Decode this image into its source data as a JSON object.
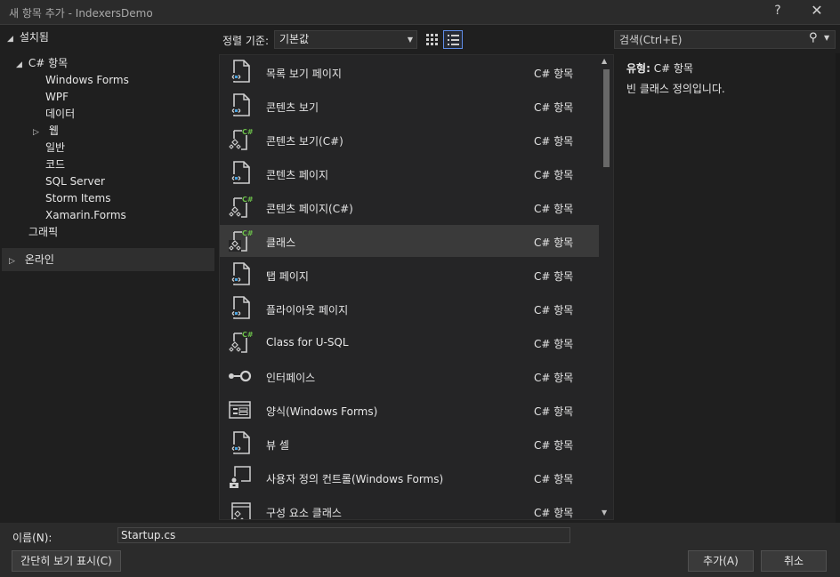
{
  "window": {
    "title": "새 항목 추가 - IndexersDemo",
    "help_glyph": "?",
    "close_glyph": "✕"
  },
  "tree": {
    "installed": "설치됨",
    "csharp_items": "C# 항목",
    "children": [
      "Windows Forms",
      "WPF",
      "데이터",
      "웹",
      "일반",
      "코드",
      "SQL Server",
      "Storm Items",
      "Xamarin.Forms"
    ],
    "graphics": "그래픽",
    "online": "온라인"
  },
  "toolbar": {
    "sort_label": "정렬 기준:",
    "sort_value": "기본값",
    "search_placeholder": "검색(Ctrl+E)"
  },
  "templates": [
    {
      "name": "목록 보기 페이지",
      "type": "C# 항목",
      "icon": "xaml-page-icon"
    },
    {
      "name": "콘텐츠 보기",
      "type": "C# 항목",
      "icon": "xaml-page-icon"
    },
    {
      "name": "콘텐츠 보기(C#)",
      "type": "C# 항목",
      "icon": "csharp-class-icon"
    },
    {
      "name": "콘텐츠 페이지",
      "type": "C# 항목",
      "icon": "xaml-page-icon"
    },
    {
      "name": "콘텐츠 페이지(C#)",
      "type": "C# 항목",
      "icon": "csharp-class-icon"
    },
    {
      "name": "클래스",
      "type": "C# 항목",
      "icon": "csharp-class-icon",
      "selected": true
    },
    {
      "name": "탭 페이지",
      "type": "C# 항목",
      "icon": "xaml-page-icon"
    },
    {
      "name": "플라이아웃 페이지",
      "type": "C# 항목",
      "icon": "xaml-page-icon"
    },
    {
      "name": "Class for U-SQL",
      "type": "C# 항목",
      "icon": "csharp-class-icon"
    },
    {
      "name": "인터페이스",
      "type": "C# 항목",
      "icon": "interface-icon"
    },
    {
      "name": "양식(Windows Forms)",
      "type": "C# 항목",
      "icon": "form-icon"
    },
    {
      "name": "뷰 셀",
      "type": "C# 항목",
      "icon": "xaml-page-icon"
    },
    {
      "name": "사용자 정의 컨트롤(Windows Forms)",
      "type": "C# 항목",
      "icon": "user-control-icon"
    },
    {
      "name": "구성 요소 클래스",
      "type": "C# 항목",
      "icon": "component-class-icon"
    }
  ],
  "details": {
    "type_label": "유형:",
    "type_value": "C# 항목",
    "description": "빈 클래스 정의입니다."
  },
  "bottom": {
    "name_label": "이름(N):",
    "name_value": "Startup.cs",
    "compact_view": "간단히 보기 표시(C)",
    "add": "추가(A)",
    "cancel": "취소"
  },
  "colors": {
    "background": "#1f1f1f",
    "selection": "#3a3a3a",
    "accent_green": "#6cc04a",
    "accent_blue": "#4aa3df"
  }
}
